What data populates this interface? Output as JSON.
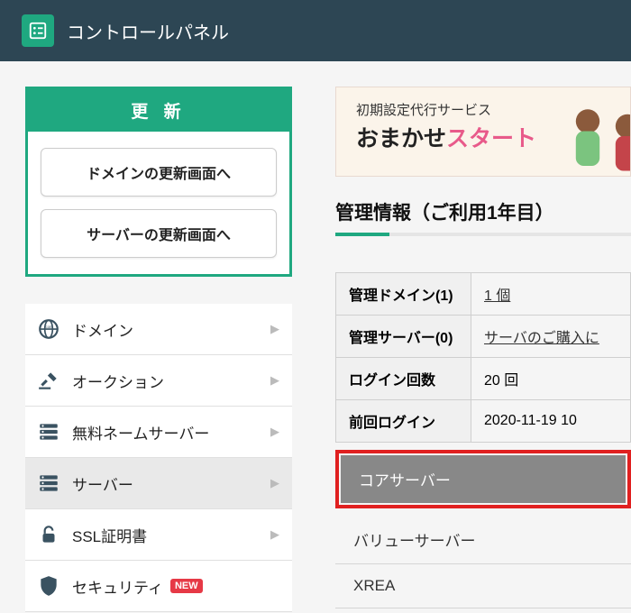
{
  "header": {
    "title": "コントロールパネル"
  },
  "update": {
    "header": "更 新",
    "btn_domain": "ドメインの更新画面へ",
    "btn_server": "サーバーの更新画面へ"
  },
  "nav": {
    "items": [
      {
        "label": "ドメイン"
      },
      {
        "label": "オークション"
      },
      {
        "label": "無料ネームサーバー"
      },
      {
        "label": "サーバー"
      },
      {
        "label": "SSL証明書"
      },
      {
        "label": "セキュリティ",
        "new": "NEW"
      }
    ]
  },
  "promo": {
    "sub": "初期設定代行サービス",
    "main_a": "おまかせ",
    "main_b": "スタート"
  },
  "info": {
    "title": "管理情報（ご利用1年目）",
    "rows": [
      {
        "th": "管理ドメイン(1)",
        "td": "1 個",
        "link": true
      },
      {
        "th": "管理サーバー(0)",
        "td": "サーバのご購入に",
        "link": true
      },
      {
        "th": "ログイン回数",
        "td": "20 回"
      },
      {
        "th": "前回ログイン",
        "td": "2020-11-19 10"
      }
    ]
  },
  "submenu": {
    "core": "コアサーバー",
    "value": "バリューサーバー",
    "xrea": "XREA"
  }
}
